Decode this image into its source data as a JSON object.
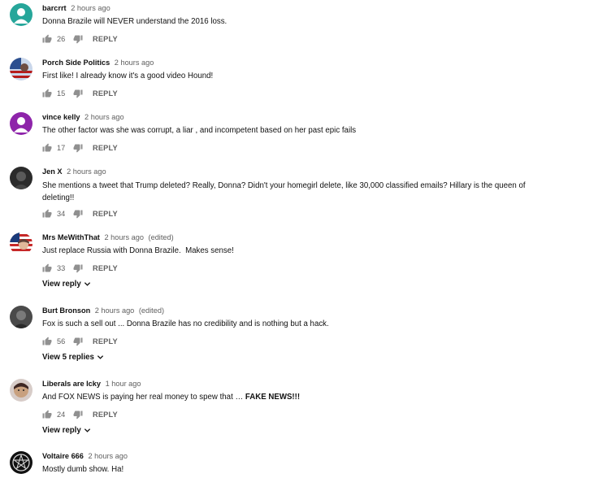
{
  "comments": [
    {
      "author": "barcrrt",
      "time": "2 hours ago",
      "edited": "",
      "text": "Donna Brazile will NEVER understand the 2016 loss.",
      "likes": "26",
      "reply_label": "REPLY",
      "view_replies": "",
      "avatar": {
        "kind": "initial",
        "bg": "#26a69a",
        "icon": "person-silhouette-icon"
      }
    },
    {
      "author": "Porch Side Politics",
      "time": "2 hours ago",
      "edited": "",
      "text": "First like! I already know it's a good video Hound!",
      "likes": "15",
      "reply_label": "REPLY",
      "view_replies": "",
      "avatar": {
        "kind": "photo",
        "bg": "#4a6fa5",
        "icon": "flag-photo-avatar"
      }
    },
    {
      "author": "vince kelly",
      "time": "2 hours ago",
      "edited": "",
      "text": "The other factor was she was corrupt, a liar , and incompetent based on her past epic fails",
      "likes": "17",
      "reply_label": "REPLY",
      "view_replies": "",
      "avatar": {
        "kind": "initial",
        "bg": "#8e24aa",
        "icon": "person-silhouette-icon"
      }
    },
    {
      "author": "Jen X",
      "time": "2 hours ago",
      "edited": "",
      "text_line1": "She mentions a tweet that Trump deleted? Really, Donna? Didn't your homegirl delete, like 30,000 classified emails? Hillary is the queen of",
      "text_line2": "deleting!!",
      "likes": "34",
      "reply_label": "REPLY",
      "view_replies": "",
      "avatar": {
        "kind": "photo",
        "bg": "#2b2b2b",
        "icon": "dark-photo-avatar"
      }
    },
    {
      "author": "Mrs MeWithThat",
      "time": "2 hours ago",
      "edited": "(edited)",
      "text": "Just replace Russia with Donna Brazile.  Makes sense!",
      "likes": "33",
      "reply_label": "REPLY",
      "view_replies": "View reply",
      "avatar": {
        "kind": "photo",
        "bg": "#c62828",
        "icon": "us-flag-photo-avatar"
      }
    },
    {
      "author": "Burt Bronson",
      "time": "2 hours ago",
      "edited": "(edited)",
      "text": "Fox is such a sell out ... Donna Brazile has no credibility and is nothing but a hack.",
      "likes": "56",
      "reply_label": "REPLY",
      "view_replies": "View 5 replies",
      "avatar": {
        "kind": "photo",
        "bg": "#3a3a3a",
        "icon": "man-photo-avatar"
      }
    },
    {
      "author": "Liberals are Icky",
      "time": "1 hour ago",
      "edited": "",
      "text_plain": "And FOX NEWS is paying her real money to spew that … ",
      "text_bold": "FAKE NEWS!!!",
      "likes": "24",
      "reply_label": "REPLY",
      "view_replies": "View reply",
      "avatar": {
        "kind": "photo",
        "bg": "#8d6e63",
        "icon": "face-photo-avatar"
      }
    },
    {
      "author": "Voltaire 666",
      "time": "2 hours ago",
      "edited": "",
      "text": "Mostly dumb show. Ha!",
      "avatar": {
        "kind": "photo",
        "bg": "#111111",
        "icon": "pentagram-avatar"
      }
    }
  ]
}
